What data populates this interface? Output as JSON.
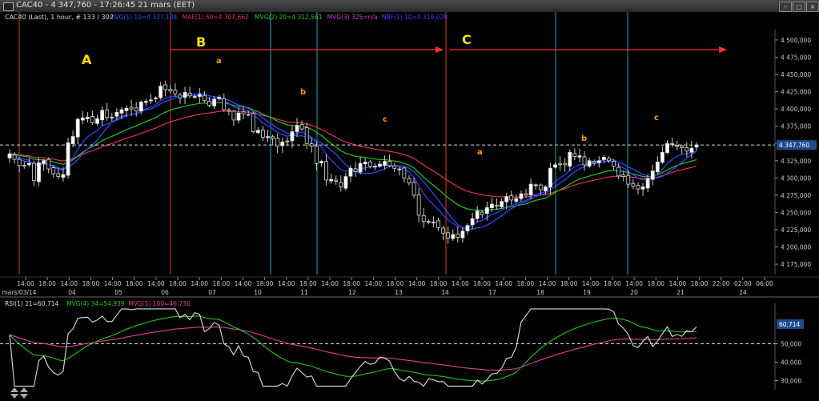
{
  "window": {
    "title": "CAC40 - 4 347,760 - 17:26:45  21 mars (EET)",
    "buttons": [
      "–",
      "□",
      "×"
    ]
  },
  "legend": {
    "instrument": "CAC40 (Last), 1 hour, # 133 / 302",
    "items": [
      {
        "text": "MVG(1) 10=4 337,104",
        "color": "#2c54ff"
      },
      {
        "text": "MAE(1) 50=4 307,662",
        "color": "#e83050"
      },
      {
        "text": "MVG(2) 20=4 312,561",
        "color": "#22c422"
      },
      {
        "text": "MVG(3) 325=n/a",
        "color": "#d040d0"
      },
      {
        "text": "NBF(1) 10=4 319,028",
        "color": "#3840ff"
      }
    ]
  },
  "rsi_legend": {
    "items": [
      {
        "text": "RSI(1) 21=60,714",
        "color": "#dddddd"
      },
      {
        "text": "MVG(4) 34=54,939",
        "color": "#22c422"
      },
      {
        "text": "MVG(5) 100=46,736",
        "color": "#e040a0"
      }
    ]
  },
  "annotations": {
    "waves": [
      {
        "label": "A",
        "color": "#ffe000"
      },
      {
        "label": "B",
        "color": "#ffe000"
      },
      {
        "label": "C",
        "color": "#ffe000"
      }
    ],
    "orange": [
      {
        "label": "a",
        "color": "#ff9900"
      },
      {
        "label": "b",
        "color": "#ff9900"
      },
      {
        "label": "c",
        "color": "#ff9900"
      },
      {
        "label": "b",
        "color": "#ff9900"
      },
      {
        "label": "c",
        "color": "#ff9900"
      }
    ],
    "arrow_color": "#ff3030"
  },
  "chart_data": [
    {
      "type": "candlestick",
      "title": "CAC40 (Last), 1 hour",
      "y_ticks": [
        4175,
        4200,
        4225,
        4250,
        4275,
        4300,
        4325,
        4350,
        4375,
        4400,
        4425,
        4450,
        4475,
        4500
      ],
      "y_tick_labels": [
        "4 175,000",
        "4 200,000",
        "4 225,000",
        "4 250,000",
        "4 275,000",
        "4 300,000",
        "4 325,000",
        "4 350,000",
        "4 375,000",
        "4 400,000",
        "4 425,000",
        "4 450,000",
        "4 475,000",
        "4 500,000"
      ],
      "ylim": [
        4160,
        4515
      ],
      "last_price": 4347.76,
      "last_price_label": "4 347,760",
      "x_time_labels": [
        "14:00",
        "18:00",
        "14:00",
        "18:00",
        "14:00",
        "18:00",
        "14:00",
        "18:00",
        "14:00",
        "18:00",
        "14:00",
        "18:00",
        "14:00",
        "18:00",
        "14:00",
        "18:00",
        "14:00",
        "18:00",
        "14:00",
        "18:00",
        "14:00",
        "18:00",
        "14:00",
        "18:00",
        "14:00",
        "18:00",
        "14:00",
        "18:00",
        "14:00",
        "18:00",
        "14:00",
        "18:00",
        "22:00",
        "02:00",
        "06:00"
      ],
      "x_date_labels": [
        "mars/03/14",
        "04",
        "05",
        "06",
        "07",
        "10",
        "11",
        "12",
        "13",
        "14",
        "17",
        "18",
        "19",
        "20",
        "21",
        "24"
      ],
      "close": [
        4335,
        4327,
        4318,
        4318,
        4321,
        4296,
        4322,
        4325,
        4313,
        4306,
        4302,
        4305,
        4351,
        4360,
        4385,
        4387,
        4388,
        4380,
        4386,
        4398,
        4388,
        4388,
        4395,
        4399,
        4401,
        4400,
        4397,
        4410,
        4411,
        4413,
        4416,
        4433,
        4428,
        4426,
        4422,
        4416,
        4424,
        4419,
        4418,
        4421,
        4412,
        4405,
        4414,
        4417,
        4399,
        4397,
        4384,
        4394,
        4393,
        4392,
        4367,
        4369,
        4359,
        4360,
        4357,
        4346,
        4352,
        4353,
        4367,
        4376,
        4371,
        4350,
        4346,
        4321,
        4324,
        4297,
        4298,
        4295,
        4287,
        4302,
        4314,
        4309,
        4321,
        4323,
        4317,
        4317,
        4320,
        4324,
        4318,
        4314,
        4313,
        4300,
        4293,
        4275,
        4246,
        4237,
        4237,
        4236,
        4228,
        4220,
        4213,
        4218,
        4214,
        4223,
        4231,
        4241,
        4252,
        4247,
        4257,
        4262,
        4259,
        4266,
        4273,
        4268,
        4270,
        4277,
        4275,
        4291,
        4290,
        4283,
        4287,
        4314,
        4319,
        4320,
        4319,
        4337,
        4331,
        4332,
        4319,
        4325,
        4322,
        4325,
        4330,
        4325,
        4317,
        4303,
        4302,
        4291,
        4288,
        4284,
        4287,
        4299,
        4310,
        4323,
        4337,
        4350,
        4349,
        4346,
        4344,
        4339,
        4343,
        4347.76
      ],
      "series": [
        {
          "name": "MVG(1) 10",
          "color": "#2c54ff",
          "last": 4337.104
        },
        {
          "name": "MAE(1) 50",
          "color": "#e83050",
          "last": 4307.662
        },
        {
          "name": "MVG(2) 20",
          "color": "#22c422",
          "last": 4312.561
        },
        {
          "name": "NBF(1) 10",
          "color": "#3840ff",
          "last": 4319.028
        }
      ]
    },
    {
      "type": "line",
      "title": "RSI(1) 21",
      "y_ticks": [
        30,
        40,
        50
      ],
      "y_tick_labels": [
        "30,000",
        "40,000",
        "50,000"
      ],
      "ylim": [
        25,
        72
      ],
      "reference_line": 50,
      "last_value_label": "60,714",
      "series": [
        {
          "name": "RSI(1) 21",
          "color": "#dddddd",
          "last": 60.714
        },
        {
          "name": "MVG(4) 34",
          "color": "#22c422",
          "last": 54.939
        },
        {
          "name": "MVG(5) 100",
          "color": "#e040a0",
          "last": 46.736
        }
      ]
    }
  ]
}
